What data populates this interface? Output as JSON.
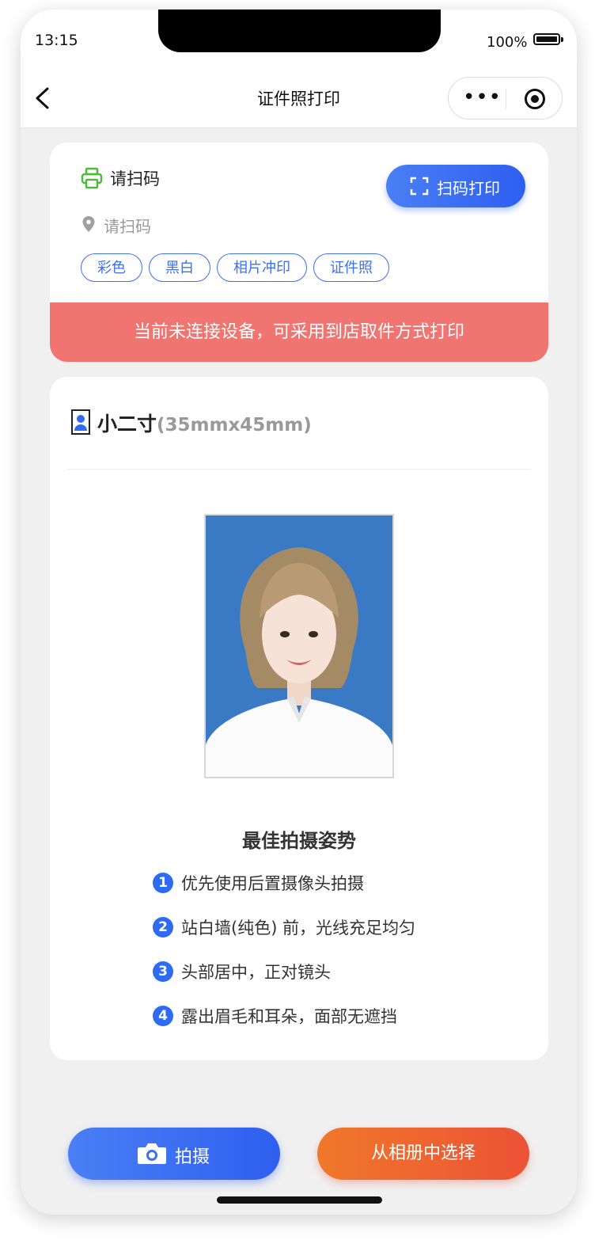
{
  "status_bar": {
    "time": "13:15",
    "battery": "100%"
  },
  "nav": {
    "title": "证件照打印",
    "more_icon": "more-dots-icon",
    "close_icon": "target-circle-icon"
  },
  "device": {
    "name": "请扫码",
    "location": "请扫码",
    "scan_button": "扫码打印",
    "tags": [
      "彩色",
      "黑白",
      "相片冲印",
      "证件照"
    ],
    "alert": "当前未连接设备，可采用到店取件方式打印"
  },
  "spec": {
    "name": "小二寸",
    "size": "(35mmx45mm)"
  },
  "tips": {
    "title": "最佳拍摄姿势",
    "items": [
      {
        "num": "1",
        "text": "优先使用后置摄像头拍摄"
      },
      {
        "num": "2",
        "text": "站白墙(纯色) 前，光线充足均匀"
      },
      {
        "num": "3",
        "text": "头部居中，正对镜头"
      },
      {
        "num": "4",
        "text": "露出眉毛和耳朵，面部无遮挡"
      }
    ]
  },
  "actions": {
    "shoot": "拍摄",
    "album": "从相册中选择"
  },
  "colors": {
    "primary": "#2e5ff0",
    "alert": "#f07570",
    "orange": "#ec5236",
    "printer_green": "#4cbb3a"
  }
}
